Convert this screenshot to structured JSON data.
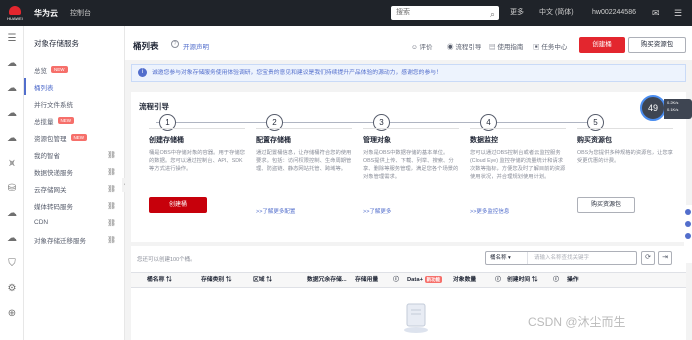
{
  "topbar": {
    "logo_text": "HUAWEI",
    "brand": "华为云",
    "console": "控制台",
    "search_placeholder": "搜索",
    "more": "更多",
    "language": "中文 (简体)",
    "username": "hw002244586"
  },
  "nav": {
    "title": "对象存储服务",
    "items": [
      {
        "label": "总览",
        "badge": "NEW"
      },
      {
        "label": "桶列表",
        "badge": ""
      },
      {
        "label": "并行文件系统",
        "badge": ""
      },
      {
        "label": "总揽量",
        "badge": "NEW"
      },
      {
        "label": "资源包管理",
        "badge": "NEW"
      },
      {
        "label": "我的智省",
        "badge": ""
      },
      {
        "label": "数据快递服务",
        "badge": ""
      },
      {
        "label": "云存储网关",
        "badge": ""
      },
      {
        "label": "媒体转码服务",
        "badge": ""
      },
      {
        "label": "CDN",
        "badge": ""
      },
      {
        "label": "对象存储迁移服务",
        "badge": ""
      }
    ]
  },
  "header": {
    "title": "桶列表",
    "link": "开源声明",
    "actions": [
      "评价",
      "流程引导",
      "使用指南",
      "任务中心"
    ],
    "create_bucket": "创建桶",
    "buy_package": "购买资源包"
  },
  "notice": "诚邀您参与对象存储服务使用体验调研，您宝贵的意见和建议是我们持续提升产品体验的源动力，感谢您的参与！",
  "flow": {
    "title": "流程引导",
    "steps": [
      {
        "num": "1",
        "title": "创建存储桶",
        "desc": "桶是OBS中存储对象的容器。用于存储您的数据。您可以通过控制台、API、SDK等方式进行操作。",
        "button": "创建桶"
      },
      {
        "num": "2",
        "title": "配置存储桶",
        "desc": "通过配置桶信息，让存储桶符合您的使用要求。包括：访问权限控制、生命周期管理、防盗链、静态网站托管、跨域等。",
        "link": ">>了解更多配置"
      },
      {
        "num": "3",
        "title": "管理对象",
        "desc": "对象是OBS中数据存储的基本单位。OBS提供上传、下载、列举、搜索、分享、删除等服务管理，满足您各个场景的对象管理需求。",
        "link": ">>了解更多"
      },
      {
        "num": "4",
        "title": "数据监控",
        "desc": "您可以通过OBS控制台或者云监控服务 (Cloud Eye) 监控存储的流量统计和请求次数等指标，方便您及时了解目前的资源使用状况，并合理规划使用计划。",
        "link": ">>更多监控信息"
      },
      {
        "num": "5",
        "title": "购买资源包",
        "desc": "OBS为您提供多种规格的资源包，让您享受更优惠的计费。",
        "button": "购买资源包"
      }
    ]
  },
  "table": {
    "quota": "您还可以创建100个桶。",
    "filter_select": "桶名称",
    "filter_placeholder": "请输入名称查找关键字",
    "columns": [
      "桶名称 ⇅",
      "存储类别 ⇅",
      "区域 ⇅",
      "数据冗余存储...",
      "存储用量",
      "Data+",
      "对象数量",
      "创建时间 ⇅",
      "操作"
    ],
    "data_badge": "新功能"
  },
  "floating": {
    "score": "49",
    "stat1": "0.2K/s",
    "stat2": "0.1K/s"
  },
  "watermark": "CSDN @沐尘而生"
}
